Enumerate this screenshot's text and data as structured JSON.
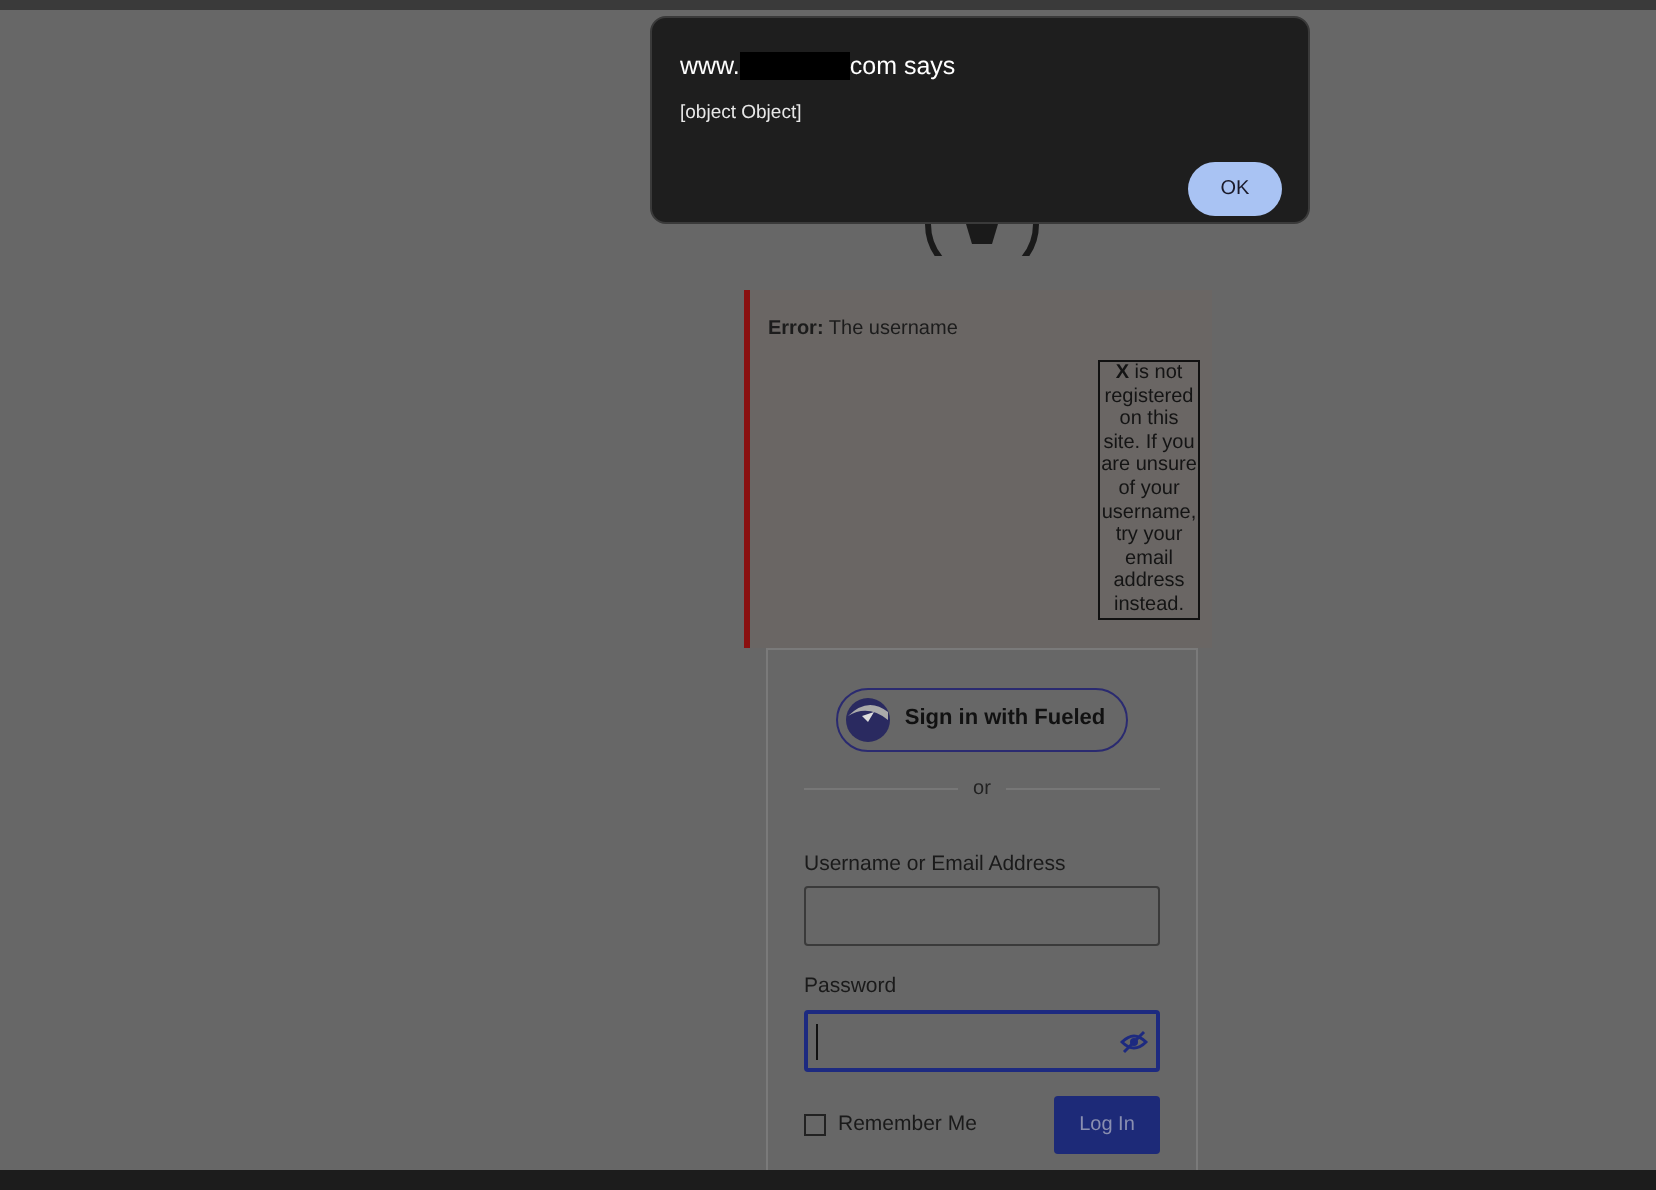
{
  "dialog": {
    "title_start": "www.",
    "title_end": "com says",
    "message": "[object Object]",
    "button": "OK"
  },
  "error": {
    "label": "Error:",
    "text": "The username",
    "note": "**X** is not registered on this site. If you are unsure of your username, try your email address instead."
  },
  "login": {
    "sso_button": "Sign in with Fueled",
    "divider": "or",
    "username": {
      "label": "Username or Email Address"
    },
    "password": {
      "label": "Password",
      "focused": true
    },
    "remember": {
      "label": "Remember Me",
      "checked": false
    },
    "submit": "Log In"
  }
}
